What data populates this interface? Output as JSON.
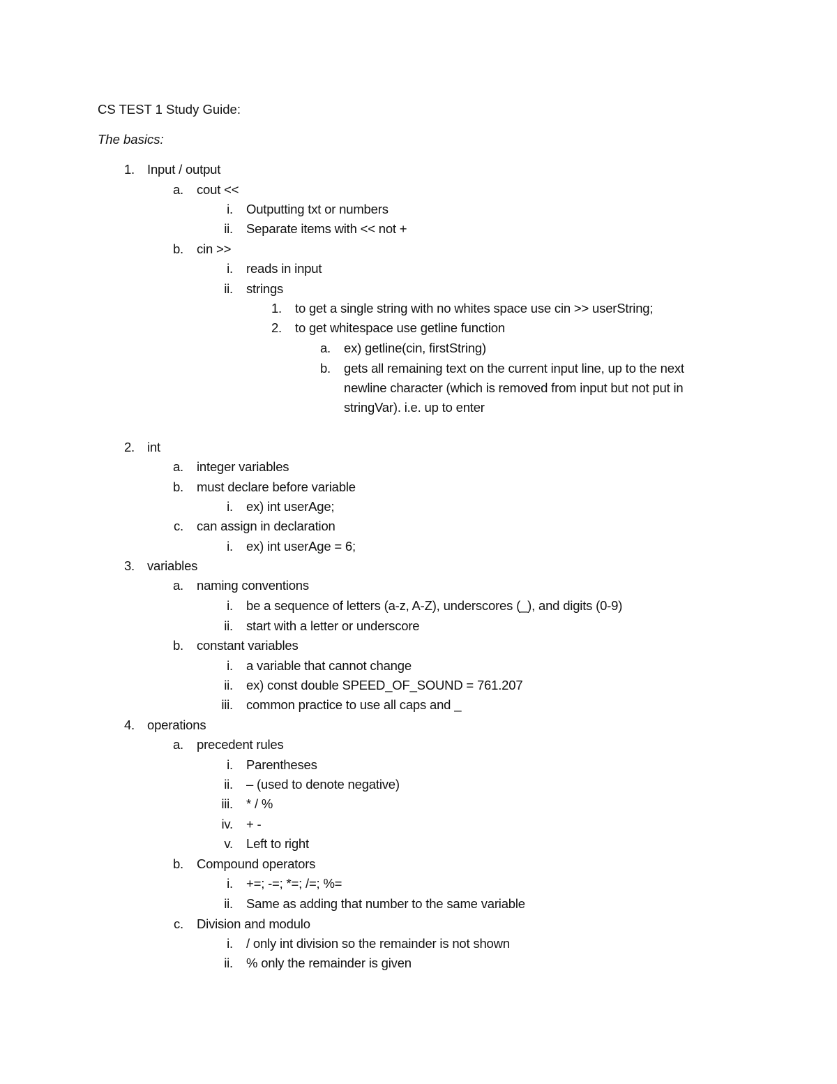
{
  "document": {
    "title": "CS TEST 1 Study Guide:",
    "subtitle": "The basics:",
    "lines": [
      {
        "marker": "1.",
        "text": "Input / output",
        "level": 1
      },
      {
        "marker": "a.",
        "text": "cout <<",
        "level": 2
      },
      {
        "marker": "i.",
        "text": "Outputting txt or numbers",
        "level": 3
      },
      {
        "marker": "ii.",
        "text": "Separate items with << not +",
        "level": 3
      },
      {
        "marker": "b.",
        "text": "cin >>",
        "level": 2
      },
      {
        "marker": "i.",
        "text": "reads in input",
        "level": 3
      },
      {
        "marker": "ii.",
        "text": "strings",
        "level": 3
      },
      {
        "marker": "1.",
        "text": "to get a single string with no whites space use cin >> userString;",
        "level": 4
      },
      {
        "marker": "2.",
        "text": "to get whitespace use getline function",
        "level": 4
      },
      {
        "marker": "a.",
        "text": "ex) getline(cin, firstString)",
        "level": 5
      },
      {
        "marker": "b.",
        "text": "gets all remaining text on the current input line, up to the next",
        "level": 5
      },
      {
        "marker": "",
        "text": "newline character (which is removed from input but not put in",
        "level": 5
      },
      {
        "marker": "",
        "text": "stringVar). i.e. up to enter",
        "level": 5
      },
      {
        "marker": "2.",
        "text": "int",
        "level": 1
      },
      {
        "marker": "a.",
        "text": "integer variables",
        "level": 2
      },
      {
        "marker": "b.",
        "text": "must declare before variable",
        "level": 2
      },
      {
        "marker": "i.",
        "text": "ex) int userAge;",
        "level": 3
      },
      {
        "marker": "c.",
        "text": "can assign in declaration",
        "level": 2
      },
      {
        "marker": "i.",
        "text": "ex) int userAge = 6;",
        "level": 3
      },
      {
        "marker": "3.",
        "text": "variables",
        "level": 1
      },
      {
        "marker": "a.",
        "text": "naming conventions",
        "level": 2
      },
      {
        "marker": "i.",
        "text": "be a sequence of letters (a-z, A-Z), underscores (_), and digits (0-9)",
        "level": 3
      },
      {
        "marker": "ii.",
        "text": "start with a letter or underscore",
        "level": 3
      },
      {
        "marker": "b.",
        "text": "constant variables",
        "level": 2
      },
      {
        "marker": "i.",
        "text": "a variable that cannot change",
        "level": 3
      },
      {
        "marker": "ii.",
        "text": "ex) const double SPEED_OF_SOUND = 761.207",
        "level": 3
      },
      {
        "marker": "iii.",
        "text": "common practice to use all caps and _",
        "level": 3
      },
      {
        "marker": "4.",
        "text": "operations",
        "level": 1
      },
      {
        "marker": "a.",
        "text": "precedent rules",
        "level": 2
      },
      {
        "marker": "i.",
        "text": "Parentheses",
        "level": 3
      },
      {
        "marker": "ii.",
        "text": "– (used to denote negative)",
        "level": 3
      },
      {
        "marker": "iii.",
        "text": "* / %",
        "level": 3
      },
      {
        "marker": "iv.",
        "text": "+ -",
        "level": 3
      },
      {
        "marker": "v.",
        "text": "Left to right",
        "level": 3
      },
      {
        "marker": "b.",
        "text": "Compound operators",
        "level": 2
      },
      {
        "marker": "i.",
        "text": "+=; -=; *=; /=; %=",
        "level": 3
      },
      {
        "marker": "ii.",
        "text": "Same as adding that number to the same variable",
        "level": 3
      },
      {
        "marker": "c.",
        "text": "Division and modulo",
        "level": 2
      },
      {
        "marker": "i.",
        "text": "/ only int division so the remainder is not shown",
        "level": 3
      },
      {
        "marker": "ii.",
        "text": "% only the remainder is given",
        "level": 3
      }
    ]
  }
}
